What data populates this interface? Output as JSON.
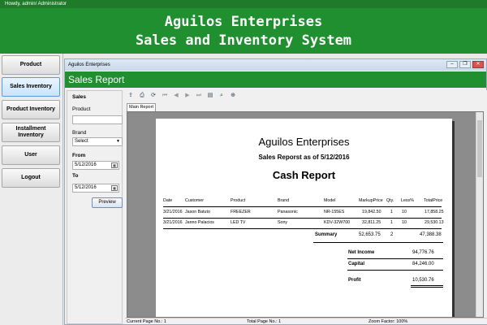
{
  "window": {
    "title": "Howdy, admin/ Administrator"
  },
  "banner": {
    "line1": "Aguilos Enterprises",
    "line2": "Sales and Inventory System"
  },
  "nav": {
    "items": [
      {
        "label": "Product"
      },
      {
        "label": "Sales Inventory"
      },
      {
        "label": "Product Inventory"
      },
      {
        "label": "Installment Inventory"
      },
      {
        "label": "User"
      },
      {
        "label": "Logout"
      }
    ]
  },
  "child": {
    "title": "Aguilos Enterprises",
    "header": "Sales Report",
    "buttons": {
      "minimize": "–",
      "restore": "❐",
      "close": "✕"
    }
  },
  "filters": {
    "section": "Sales",
    "product_label": "Product",
    "product_value": "",
    "brand_label": "Brand",
    "brand_value": "Select",
    "from_label": "From",
    "from_value": "5/12/2016",
    "to_label": "To",
    "to_value": "5/12/2016",
    "preview_label": "Preview"
  },
  "viewer": {
    "tab": "Main Report",
    "status": {
      "current": "Current Page No.: 1",
      "total": "Total Page No.: 1",
      "zoom": "Zoom Factor: 100%"
    }
  },
  "report": {
    "company": "Aguilos Enterprises",
    "subtitle": "Sales Reporst as of 5/12/2016",
    "title": "Cash Report",
    "columns": [
      "Date",
      "Customer",
      "Product",
      "Brand",
      "Model",
      "MarkupPrice",
      "Qty.",
      "Less%",
      "TotalPrice"
    ],
    "rows": [
      [
        "3/21/2016",
        "Jason Batuto",
        "FREEZER",
        "Panasonic",
        "NR-155ES",
        "19,842.50",
        "1",
        "10",
        "17,858.25"
      ],
      [
        "3/21/2016",
        "Janno Palacios",
        "LED TV",
        "Sony",
        "KDV-32W700",
        "32,811.25",
        "1",
        "10",
        "29,530.13"
      ]
    ],
    "summary": {
      "label": "Summary",
      "markup": "52,653.75",
      "qty": "2",
      "total": "47,388.38"
    },
    "net_income_label": "Net Income",
    "net_income": "94,776.76",
    "capital_label": "Capital",
    "capital": "84,246.00",
    "profit_label": "Profit",
    "profit": "10,530.76"
  }
}
